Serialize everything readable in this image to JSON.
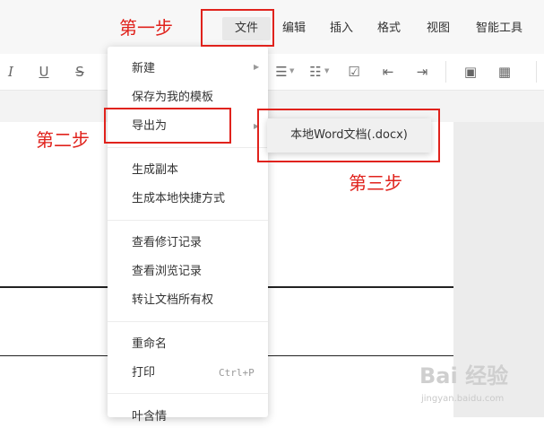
{
  "menubar": {
    "items": [
      "文件",
      "编辑",
      "插入",
      "格式",
      "视图",
      "智能工具"
    ]
  },
  "toolbar": {
    "buttons": [
      "I",
      "U",
      "S",
      "☰",
      "☷",
      "☑",
      "⇤",
      "⇥",
      "▣",
      "▦"
    ]
  },
  "file_menu": {
    "items": [
      {
        "label": "新建",
        "has_submenu": true
      },
      {
        "label": "保存为我的模板"
      },
      {
        "label": "导出为",
        "has_submenu": true
      },
      {
        "label": "生成副本"
      },
      {
        "label": "生成本地快捷方式"
      },
      {
        "label": "查看修订记录"
      },
      {
        "label": "查看浏览记录"
      },
      {
        "label": "转让文档所有权"
      },
      {
        "label": "重命名"
      },
      {
        "label": "打印",
        "shortcut": "Ctrl+P"
      },
      {
        "label": "叶含情"
      }
    ]
  },
  "export_submenu": {
    "items": [
      "本地Word文档(.docx)"
    ]
  },
  "annotations": {
    "step1": "第一步",
    "step2": "第二步",
    "step3": "第三步",
    "color": "#e0221c"
  },
  "watermark": {
    "brand": "Bai 经验",
    "url": "jingyan.baidu.com"
  }
}
